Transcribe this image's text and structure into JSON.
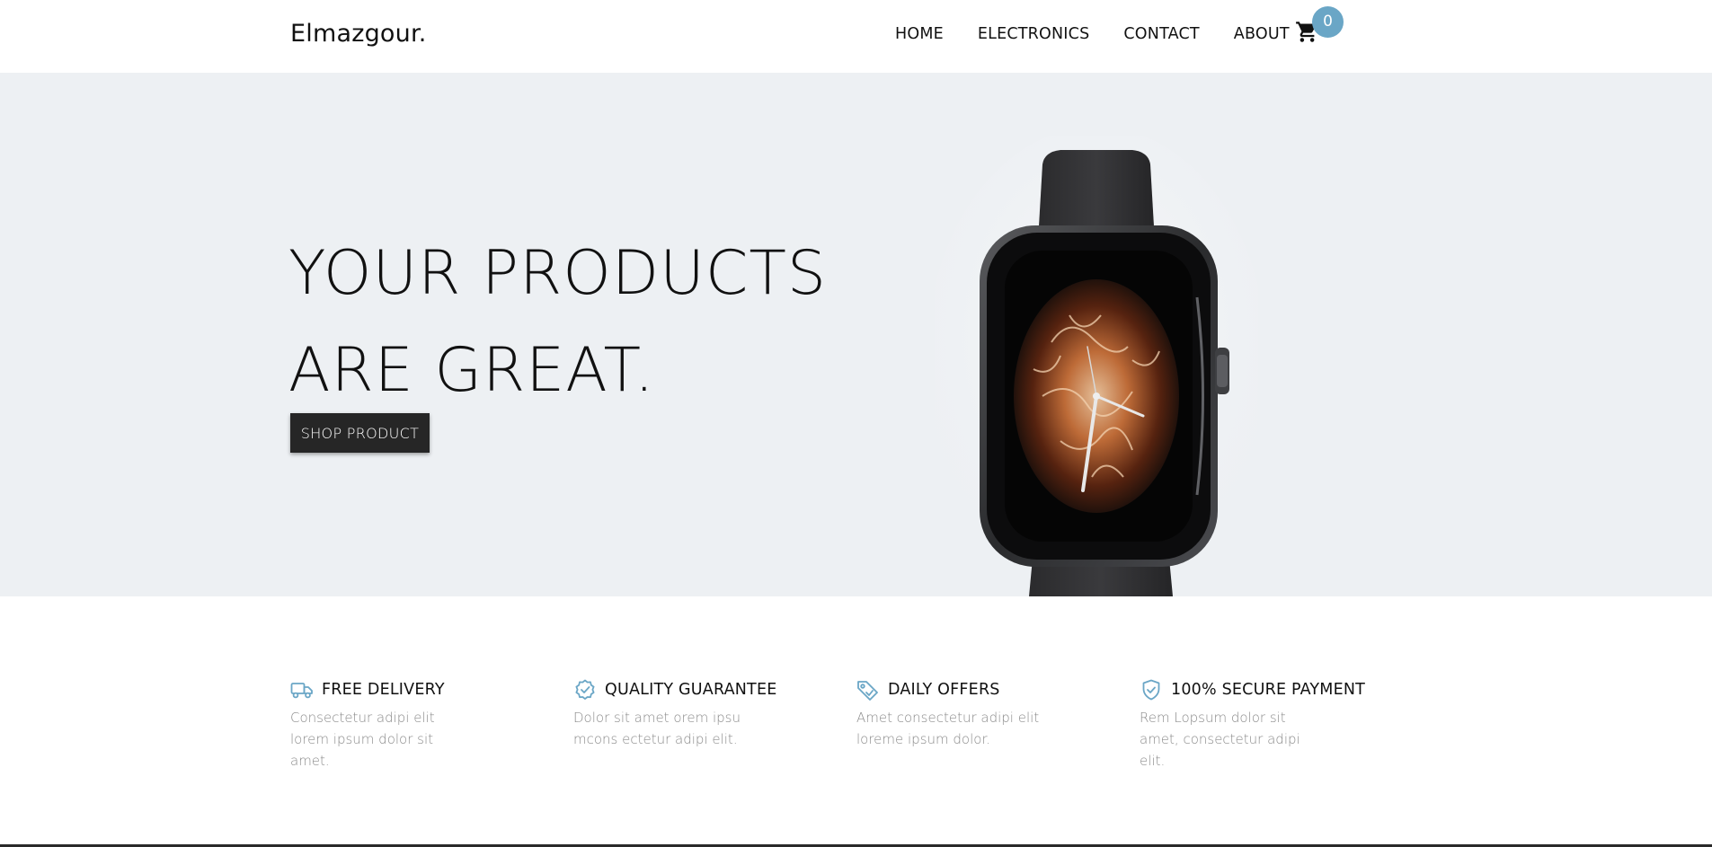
{
  "header": {
    "brand": "Elmazgour.",
    "nav": [
      "HOME",
      "ELECTRONICS",
      "CONTACT",
      "ABOUT"
    ],
    "cart_icon": "shopping-cart-icon",
    "cart_count": "0"
  },
  "hero": {
    "title_line1": "YOUR PRODUCTS",
    "title_line2": "ARE GREAT.",
    "cta_label": "SHOP PRODUCT",
    "image": "smartwatch-product-image"
  },
  "features": [
    {
      "icon": "truck-icon",
      "title": "FREE DELIVERY",
      "desc": "Consectetur adipi elit lorem ipsum dolor sit amet."
    },
    {
      "icon": "badge-check-icon",
      "title": "QUALITY GUARANTEE",
      "desc": "Dolor sit amet orem ipsu mcons ectetur adipi elit."
    },
    {
      "icon": "tag-icon",
      "title": "DAILY OFFERS",
      "desc": "Amet consectetur adipi elit loreme ipsum dolor."
    },
    {
      "icon": "shield-check-icon",
      "title": "100% SECURE PAYMENT",
      "desc": "Rem Lopsum dolor sit amet, consectetur adipi elit."
    }
  ],
  "colors": {
    "accent": "#6aa6c6",
    "hero_bg": "#edf0f3",
    "button_bg": "#262626",
    "text": "#111111",
    "muted": "#8b8b8b"
  }
}
